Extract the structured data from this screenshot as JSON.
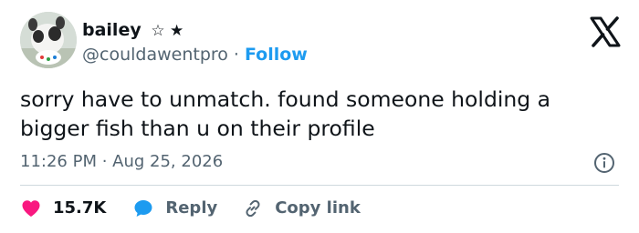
{
  "user": {
    "display_name": "bailey",
    "badges": "☆ ★",
    "handle": "@couldawentpro",
    "separator": "·",
    "follow_label": "Follow"
  },
  "tweet": {
    "text": "sorry have to unmatch. found someone holding a bigger fish than u on their profile",
    "timestamp": "11:26 PM · Aug 25, 2026"
  },
  "actions": {
    "like_count": "15.7K",
    "reply_label": "Reply",
    "copy_label": "Copy link"
  },
  "icons": {
    "logo": "x-logo-icon",
    "info": "info-icon",
    "like": "heart-icon",
    "reply": "speech-bubble-icon",
    "copy": "link-icon"
  },
  "colors": {
    "text": "#0f1419",
    "secondary": "#536471",
    "link": "#1d9bf0",
    "like": "#f91880",
    "reply": "#1d9bf0",
    "divider": "#cfd9de"
  }
}
